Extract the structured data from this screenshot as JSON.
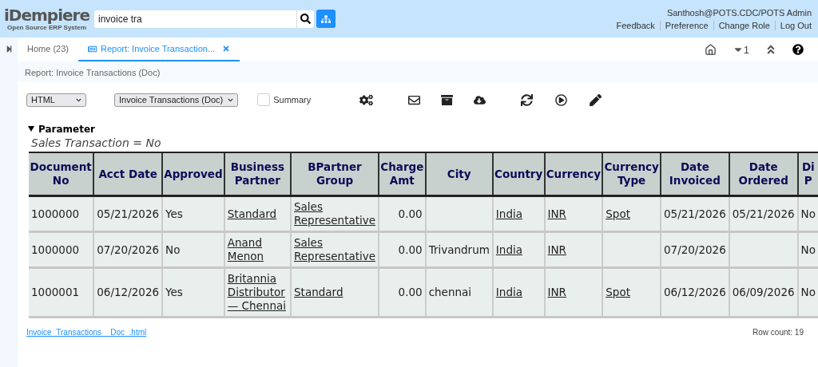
{
  "header": {
    "logo": {
      "title": "iDempiere",
      "subtitle": "Open Source ERP System"
    },
    "search": {
      "value": "invoice tra"
    },
    "user": "Santhosh@POTS.CDC/POTS Admin",
    "links": [
      "Feedback",
      "Preference",
      "Change Role",
      "Log Out"
    ]
  },
  "tabs": [
    {
      "label": "Home (23)",
      "selected": false,
      "closable": false
    },
    {
      "label": "Report: Invoice Transaction...",
      "selected": true,
      "closable": true
    }
  ],
  "tab_tools": {
    "count": "1"
  },
  "breadcrumb": "Report: Invoice Transactions (Doc)",
  "report_toolbar": {
    "format": "HTML",
    "report": "Invoice Transactions (Doc)",
    "summary": {
      "label": "Summary",
      "checked": false
    }
  },
  "parameter": {
    "title": "Parameter",
    "expanded": true,
    "lines": [
      "Sales Transaction = No"
    ]
  },
  "table": {
    "columns": [
      {
        "label": "Document No",
        "kind": "text"
      },
      {
        "label": "Acct Date",
        "kind": "text"
      },
      {
        "label": "Approved",
        "kind": "text"
      },
      {
        "label": "Business Partner",
        "kind": "link"
      },
      {
        "label": "BPartner Group",
        "kind": "link"
      },
      {
        "label": "Charge Amt",
        "kind": "amount"
      },
      {
        "label": "City",
        "kind": "text"
      },
      {
        "label": "Country",
        "kind": "link"
      },
      {
        "label": "Currency",
        "kind": "link"
      },
      {
        "label": "Currency Type",
        "kind": "link"
      },
      {
        "label": "Date Invoiced",
        "kind": "text"
      },
      {
        "label": "Date Ordered",
        "kind": "text"
      },
      {
        "label": "Di P",
        "kind": "text"
      }
    ],
    "rows": [
      [
        "1000000",
        "05/21/2026",
        "Yes",
        "Standard",
        "Sales Representative",
        "0.00",
        null,
        "India",
        "INR",
        "Spot",
        "05/21/2026",
        "05/21/2026",
        "No"
      ],
      [
        "1000000",
        "07/20/2026",
        "No",
        "Anand Menon",
        "Sales Representative",
        "0.00",
        "Trivandrum",
        "India",
        "INR",
        null,
        "07/20/2026",
        null,
        "No"
      ],
      [
        "1000001",
        "06/12/2026",
        "Yes",
        "Britannia Distributor — Chennai",
        "Standard",
        "0.00",
        "chennai",
        "India",
        "INR",
        "Spot",
        "06/12/2026",
        "06/09/2026",
        "No"
      ]
    ]
  },
  "footer": {
    "file_link": "Invoice_Transactions__Doc_.html",
    "row_count": "Row count: 19"
  }
}
